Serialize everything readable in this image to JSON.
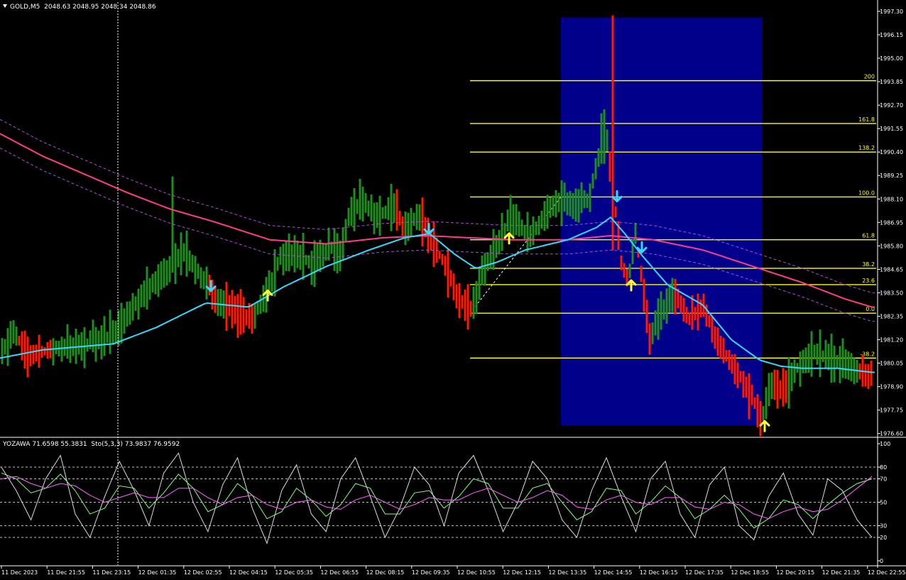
{
  "header": {
    "symbol": "GOLD,M5",
    "ohlc": "2048.63 2048.95 2048.34 2048.86"
  },
  "indicator_header": {
    "text": "YOZAWA 71.6598 55.3831  Sto(5,3,3) 73.9837 76.9592"
  },
  "colors": {
    "background": "#000000",
    "bull_bar": "#228b22",
    "bear_bar": "#ff1a00",
    "ma_fast": "#35d9ff",
    "ma_slow": "#ff3d8b",
    "envelope": "#b04ad8",
    "fibo": "#ffff00",
    "zone": "#00008b",
    "arrow_down": "#35d9ff",
    "arrow_up": "#ffff33",
    "axis_text": "#ffffff"
  },
  "chart_data": [
    {
      "type": "candlestick-bars",
      "price_axis": {
        "ticks": [
          "1997.30",
          "1996.15",
          "1995.00",
          "1993.85",
          "1992.70",
          "1991.55",
          "1990.40",
          "1989.25",
          "1988.10",
          "1986.95",
          "1985.80",
          "1984.65",
          "1983.50",
          "1982.35",
          "1981.20",
          "1980.05",
          "1978.90",
          "1977.75",
          "1976.60"
        ],
        "range": [
          1976.45,
          1997.75
        ]
      },
      "time_axis": {
        "ticks": [
          "11 Dec 2023",
          "11 Dec 21:55",
          "11 Dec 23:15",
          "12 Dec 01:35",
          "12 Dec 02:55",
          "12 Dec 04:15",
          "12 Dec 05:35",
          "12 Dec 06:55",
          "12 Dec 08:15",
          "12 Dec 09:35",
          "12 Dec 10:55",
          "12 Dec 12:15",
          "12 Dec 13:35",
          "12 Dec 14:55",
          "12 Dec 16:15",
          "12 Dec 17:35",
          "12 Dec 18:55",
          "12 Dec 20:15",
          "12 Dec 21:35",
          "12 Dec 22:55"
        ]
      },
      "price_path": [
        [
          0,
          1980.5
        ],
        [
          20,
          1981.6
        ],
        [
          40,
          1980.4
        ],
        [
          80,
          1980.8
        ],
        [
          120,
          1981.0
        ],
        [
          160,
          1981.5
        ],
        [
          200,
          1983.3
        ],
        [
          240,
          1984.7
        ],
        [
          260,
          1985.4
        ],
        [
          290,
          1984.0
        ],
        [
          305,
          1983.1
        ],
        [
          330,
          1982.7
        ],
        [
          355,
          1982.2
        ],
        [
          375,
          1983.4
        ],
        [
          395,
          1985.3
        ],
        [
          420,
          1985.4
        ],
        [
          440,
          1984.9
        ],
        [
          465,
          1985.8
        ],
        [
          480,
          1985.3
        ],
        [
          490,
          1987.2
        ],
        [
          510,
          1988.0
        ],
        [
          530,
          1987.3
        ],
        [
          555,
          1987.6
        ],
        [
          570,
          1986.6
        ],
        [
          590,
          1987.4
        ],
        [
          605,
          1986.2
        ],
        [
          625,
          1985.0
        ],
        [
          645,
          1983.2
        ],
        [
          665,
          1982.6
        ],
        [
          680,
          1984.6
        ],
        [
          700,
          1985.8
        ],
        [
          720,
          1987.3
        ],
        [
          745,
          1986.2
        ],
        [
          770,
          1987.5
        ],
        [
          790,
          1988.1
        ],
        [
          810,
          1987.8
        ],
        [
          830,
          1988.1
        ],
        [
          845,
          1990.4
        ],
        [
          855,
          1990.9
        ],
        [
          865,
          1988.0
        ],
        [
          875,
          1985.0
        ],
        [
          885,
          1984.1
        ],
        [
          895,
          1986.5
        ],
        [
          905,
          1983.9
        ],
        [
          915,
          1981.2
        ],
        [
          930,
          1982.6
        ],
        [
          950,
          1983.4
        ],
        [
          970,
          1982.2
        ],
        [
          990,
          1982.8
        ],
        [
          1005,
          1981.5
        ],
        [
          1020,
          1980.6
        ],
        [
          1040,
          1979.5
        ],
        [
          1060,
          1978.3
        ],
        [
          1073,
          1977.2
        ],
        [
          1085,
          1979.2
        ],
        [
          1105,
          1978.6
        ],
        [
          1125,
          1979.9
        ],
        [
          1150,
          1980.6
        ],
        [
          1175,
          1980.2
        ],
        [
          1200,
          1979.8
        ],
        [
          1228,
          1979.4
        ]
      ],
      "ma_fast_path": [
        [
          0,
          1980.3
        ],
        [
          60,
          1980.7
        ],
        [
          160,
          1981.0
        ],
        [
          220,
          1981.8
        ],
        [
          290,
          1983.0
        ],
        [
          350,
          1982.8
        ],
        [
          400,
          1983.8
        ],
        [
          460,
          1984.8
        ],
        [
          520,
          1985.6
        ],
        [
          570,
          1986.2
        ],
        [
          605,
          1986.4
        ],
        [
          640,
          1985.4
        ],
        [
          670,
          1984.7
        ],
        [
          700,
          1985.0
        ],
        [
          740,
          1985.6
        ],
        [
          800,
          1986.1
        ],
        [
          840,
          1986.7
        ],
        [
          860,
          1987.2
        ],
        [
          880,
          1986.4
        ],
        [
          905,
          1985.3
        ],
        [
          940,
          1983.9
        ],
        [
          990,
          1982.9
        ],
        [
          1030,
          1981.2
        ],
        [
          1070,
          1980.2
        ],
        [
          1100,
          1979.9
        ],
        [
          1130,
          1979.8
        ],
        [
          1180,
          1979.8
        ],
        [
          1228,
          1979.6
        ]
      ],
      "ma_slow_path": [
        [
          0,
          1991.3
        ],
        [
          60,
          1990.2
        ],
        [
          120,
          1989.3
        ],
        [
          180,
          1988.4
        ],
        [
          240,
          1987.6
        ],
        [
          300,
          1987.0
        ],
        [
          380,
          1986.1
        ],
        [
          460,
          1985.9
        ],
        [
          540,
          1986.2
        ],
        [
          600,
          1986.3
        ],
        [
          660,
          1986.2
        ],
        [
          720,
          1986.1
        ],
        [
          800,
          1986.1
        ],
        [
          860,
          1986.3
        ],
        [
          920,
          1986.1
        ],
        [
          990,
          1985.6
        ],
        [
          1060,
          1984.8
        ],
        [
          1130,
          1984.0
        ],
        [
          1190,
          1983.2
        ],
        [
          1228,
          1982.8
        ]
      ],
      "envelope_offset": 0.7,
      "fibo_levels": [
        {
          "label": "200",
          "price": 1993.9
        },
        {
          "label": "161.8",
          "price": 1991.8
        },
        {
          "label": "138.2",
          "price": 1990.4
        },
        {
          "label": "100.0",
          "price": 1988.2
        },
        {
          "label": "61.8",
          "price": 1986.1
        },
        {
          "label": "38.2",
          "price": 1984.7
        },
        {
          "label": "23.6",
          "price": 1983.9
        },
        {
          "label": "0.0",
          "price": 1982.5
        },
        {
          "label": "-38.2",
          "price": 1980.3
        }
      ],
      "fibo_start_bar_x": 662,
      "zone": {
        "x_from": 790,
        "x_to": 1073,
        "price_top": 1997.0,
        "price_bottom": 1977.0
      },
      "signals": [
        {
          "x": 297,
          "price": 1983.8,
          "dir": "down"
        },
        {
          "x": 377,
          "price": 1983.4,
          "dir": "up"
        },
        {
          "x": 604,
          "price": 1986.6,
          "dir": "down"
        },
        {
          "x": 717,
          "price": 1986.2,
          "dir": "up"
        },
        {
          "x": 869,
          "price": 1988.2,
          "dir": "down"
        },
        {
          "x": 889,
          "price": 1983.9,
          "dir": "up"
        },
        {
          "x": 904,
          "price": 1985.7,
          "dir": "down"
        },
        {
          "x": 1077,
          "price": 1977.0,
          "dir": "up"
        }
      ]
    },
    {
      "type": "line",
      "name": "oscillator",
      "ylim": [
        0,
        100
      ],
      "levels": [
        20,
        30,
        50,
        70,
        80
      ],
      "ticks": [
        "100",
        "80",
        "70",
        "50",
        "30",
        "20",
        "0"
      ],
      "series": [
        {
          "color": "#dcdcdc",
          "values": [
            80,
            60,
            35,
            70,
            90,
            40,
            20,
            55,
            85,
            60,
            30,
            75,
            92,
            50,
            25,
            65,
            88,
            45,
            15,
            60,
            82,
            40,
            25,
            70,
            88,
            55,
            20,
            45,
            80,
            65,
            30,
            75,
            90,
            60,
            25,
            50,
            85,
            70,
            35,
            20,
            60,
            88,
            55,
            25,
            70,
            85,
            40,
            20,
            65,
            80,
            30,
            18,
            55,
            75,
            40,
            22,
            70,
            60,
            35,
            20
          ]
        },
        {
          "color": "#7fff7f",
          "values": [
            75,
            70,
            58,
            62,
            74,
            60,
            40,
            45,
            64,
            62,
            45,
            58,
            74,
            62,
            42,
            48,
            66,
            56,
            36,
            42,
            62,
            52,
            38,
            48,
            66,
            62,
            40,
            40,
            58,
            60,
            45,
            55,
            70,
            66,
            45,
            45,
            62,
            66,
            50,
            35,
            42,
            62,
            60,
            40,
            50,
            64,
            54,
            36,
            44,
            56,
            44,
            28,
            36,
            52,
            48,
            36,
            48,
            58,
            66,
            70
          ]
        },
        {
          "color": "#ff66ff",
          "values": [
            70,
            72,
            66,
            62,
            66,
            64,
            56,
            50,
            54,
            58,
            54,
            54,
            62,
            62,
            54,
            48,
            54,
            56,
            48,
            44,
            50,
            52,
            46,
            44,
            52,
            56,
            50,
            44,
            48,
            54,
            52,
            52,
            58,
            62,
            56,
            50,
            54,
            60,
            56,
            46,
            44,
            52,
            56,
            50,
            48,
            54,
            54,
            46,
            44,
            50,
            48,
            40,
            36,
            42,
            46,
            42,
            44,
            52,
            62,
            72
          ]
        }
      ]
    }
  ]
}
